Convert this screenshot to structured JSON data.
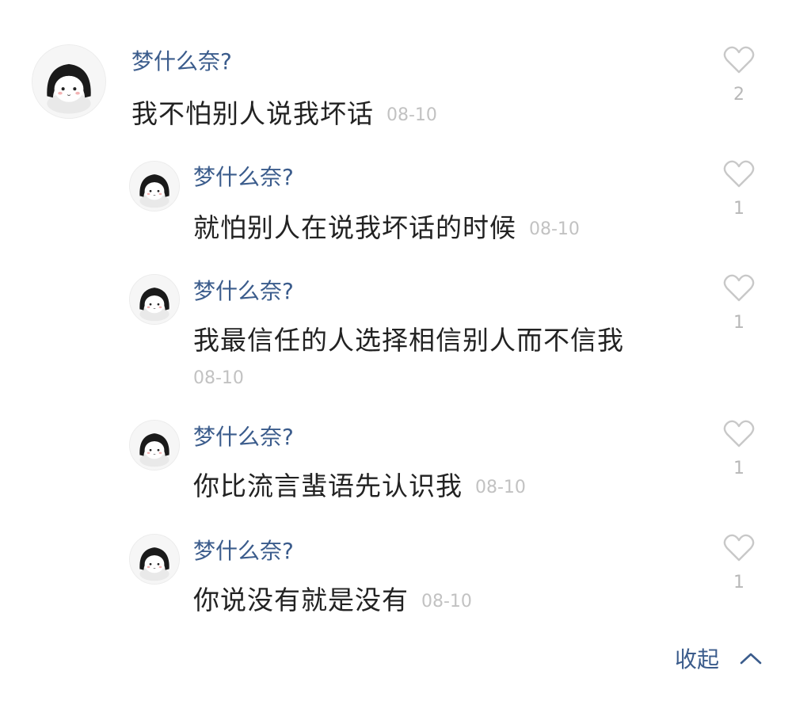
{
  "comments": [
    {
      "username": "梦什么奈?",
      "text": "我不怕别人说我坏话",
      "date": "08-10",
      "likes": "2"
    },
    {
      "username": "梦什么奈?",
      "text": "就怕别人在说我坏话的时候",
      "date": "08-10",
      "likes": "1"
    },
    {
      "username": "梦什么奈?",
      "text": "我最信任的人选择相信别人而不信我",
      "date": "08-10",
      "likes": "1"
    },
    {
      "username": "梦什么奈?",
      "text": "你比流言蜚语先认识我",
      "date": "08-10",
      "likes": "1"
    },
    {
      "username": "梦什么奈?",
      "text": "你说没有就是没有",
      "date": "08-10",
      "likes": "1"
    }
  ],
  "collapse_label": "收起",
  "icons": {
    "like": "heart-outline-icon",
    "collapse": "chevron-up-icon"
  },
  "colors": {
    "username": "#3b5c8c",
    "text": "#222222",
    "date": "#c2c2c2",
    "like_icon": "#c8c8c8"
  }
}
